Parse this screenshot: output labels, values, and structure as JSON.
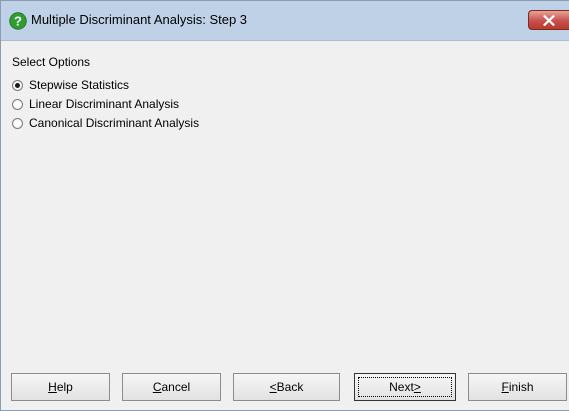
{
  "window": {
    "title": "Multiple Discriminant Analysis: Step 3",
    "title_icon": "help-question-icon",
    "close_icon": "close-icon"
  },
  "options": {
    "group_label": "Select Options",
    "items": [
      {
        "label": "Stepwise Statistics",
        "checked": true
      },
      {
        "label": "Linear Discriminant Analysis",
        "checked": false
      },
      {
        "label": "Canonical Discriminant Analysis",
        "checked": false
      }
    ]
  },
  "buttons": {
    "help": {
      "mnemonic": "H",
      "rest": "elp"
    },
    "cancel": {
      "mnemonic": "C",
      "rest": "ancel"
    },
    "back": {
      "mnemonic": "<",
      "rest": " Back"
    },
    "next": {
      "prefix": "Next ",
      "mnemonic": ">"
    },
    "finish": {
      "mnemonic": "F",
      "rest": "inish"
    }
  },
  "colors": {
    "titlebar": "#bfd1e6",
    "client_background": "#f0f0f0",
    "help_icon_green": "#2e9e32",
    "close_red": "#c75050"
  }
}
